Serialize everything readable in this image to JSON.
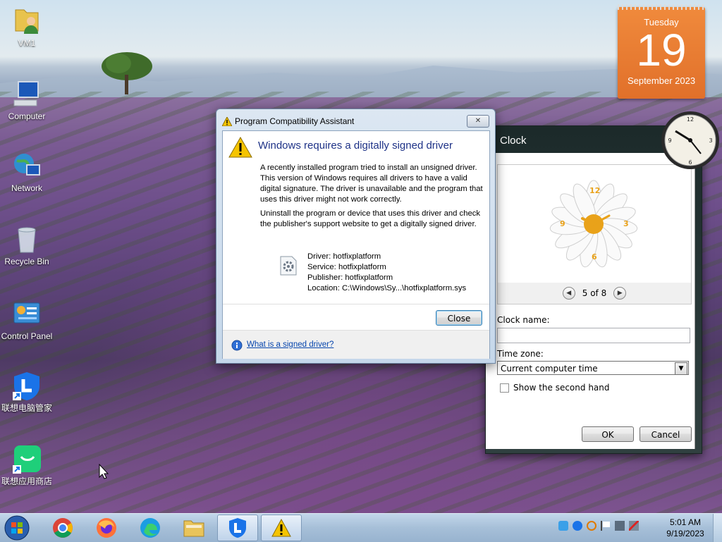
{
  "desktop": {
    "icons": [
      {
        "label": "VM1",
        "icon": "user-folder-icon"
      },
      {
        "label": "Computer",
        "icon": "computer-icon"
      },
      {
        "label": "Network",
        "icon": "network-icon"
      },
      {
        "label": "Recycle Bin",
        "icon": "recycle-bin-icon"
      },
      {
        "label": "Control Panel",
        "icon": "control-panel-icon"
      },
      {
        "label": "联想电脑管家",
        "icon": "lenovo-pc-manager-icon"
      },
      {
        "label": "联想应用商店",
        "icon": "lenovo-app-store-icon"
      }
    ]
  },
  "calendar_gadget": {
    "weekday": "Tuesday",
    "day": "19",
    "month_year": "September 2023",
    "accent": "#e8782f"
  },
  "clock_settings": {
    "title": "Clock",
    "pager": "5 of 8",
    "clock_name_label": "Clock name:",
    "clock_name_value": "",
    "time_zone_label": "Time zone:",
    "time_zone_value": "Current computer time",
    "second_hand_label": "Show the second hand",
    "second_hand_checked": false,
    "ok": "OK",
    "cancel": "Cancel",
    "face_numbers": [
      "12",
      "3",
      "6",
      "9"
    ]
  },
  "dialog": {
    "title": "Program Compatibility Assistant",
    "heading": "Windows requires a digitally signed driver",
    "para1": "A recently installed program tried to install an unsigned driver. This version of Windows requires all drivers to have a valid digital signature. The driver is unavailable and the program that uses this driver might not work correctly.",
    "para2": "Uninstall the program or device that uses this driver and check the publisher's support website to get a digitally signed driver.",
    "driver": "Driver: hotfixplatform",
    "service": "Service: hotfixplatform",
    "publisher": "Publisher: hotfixplatform",
    "location": "Location: C:\\Windows\\Sy...\\hotfixplatform.sys",
    "close_button": "Close",
    "help_link": "What is a signed driver?",
    "close_x": "✕"
  },
  "taskbar": {
    "apps": [
      "chrome",
      "firefox",
      "edge",
      "file-explorer",
      "lenovo-pc-manager",
      "warning"
    ],
    "time": "5:01 AM",
    "date": "9/19/2023"
  }
}
